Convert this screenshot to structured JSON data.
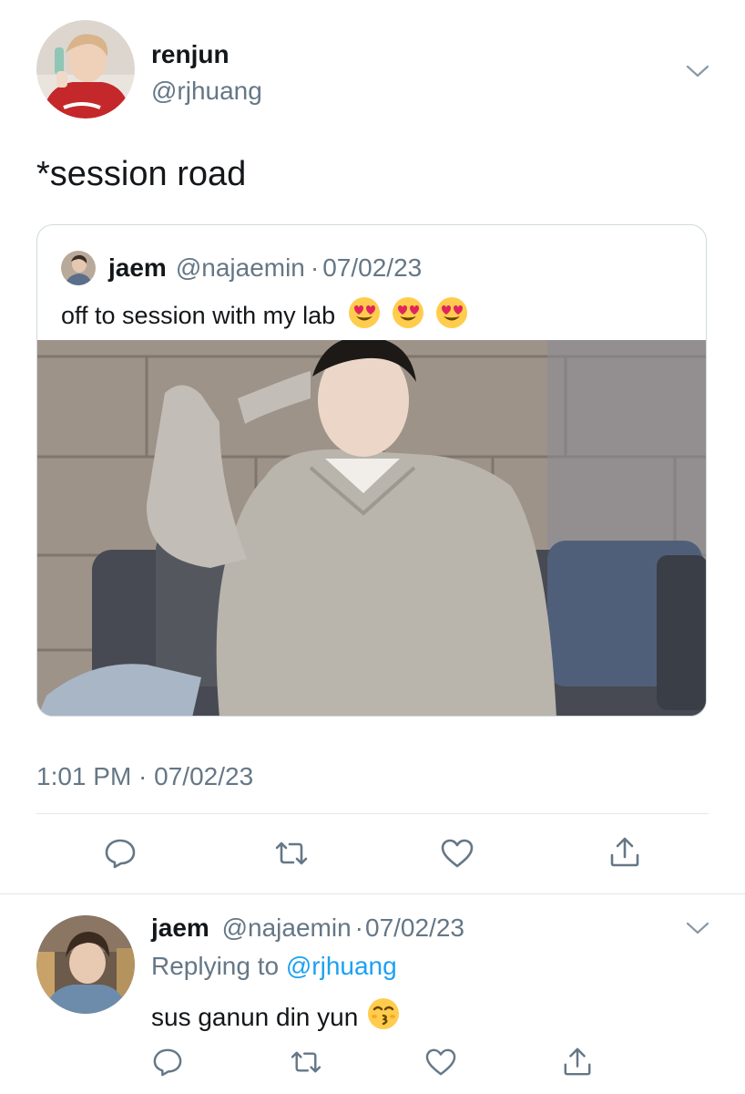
{
  "main_tweet": {
    "author_name": "renjun",
    "author_handle": "@rjhuang",
    "text": "*session road",
    "timestamp": "1:01 PM · 07/02/23"
  },
  "quoted_tweet": {
    "author_name": "jaem",
    "author_handle": "@najaemin",
    "separator": "·",
    "date": "07/02/23",
    "text": "off to session with my lab"
  },
  "reply": {
    "author_name": "jaem",
    "author_handle": "@najaemin",
    "separator": "·",
    "date": "07/02/23",
    "replying_prefix": "Replying to",
    "replying_to": "@rjhuang",
    "text": "sus ganun din yun"
  },
  "icons": {
    "reply": "reply-icon",
    "retweet": "retweet-icon",
    "like": "heart-icon",
    "share": "share-icon",
    "more": "chevron-down-icon"
  },
  "colors": {
    "name": "#14171a",
    "secondary": "#657786",
    "link": "#1da1f2",
    "divider": "#e1e8ed"
  }
}
